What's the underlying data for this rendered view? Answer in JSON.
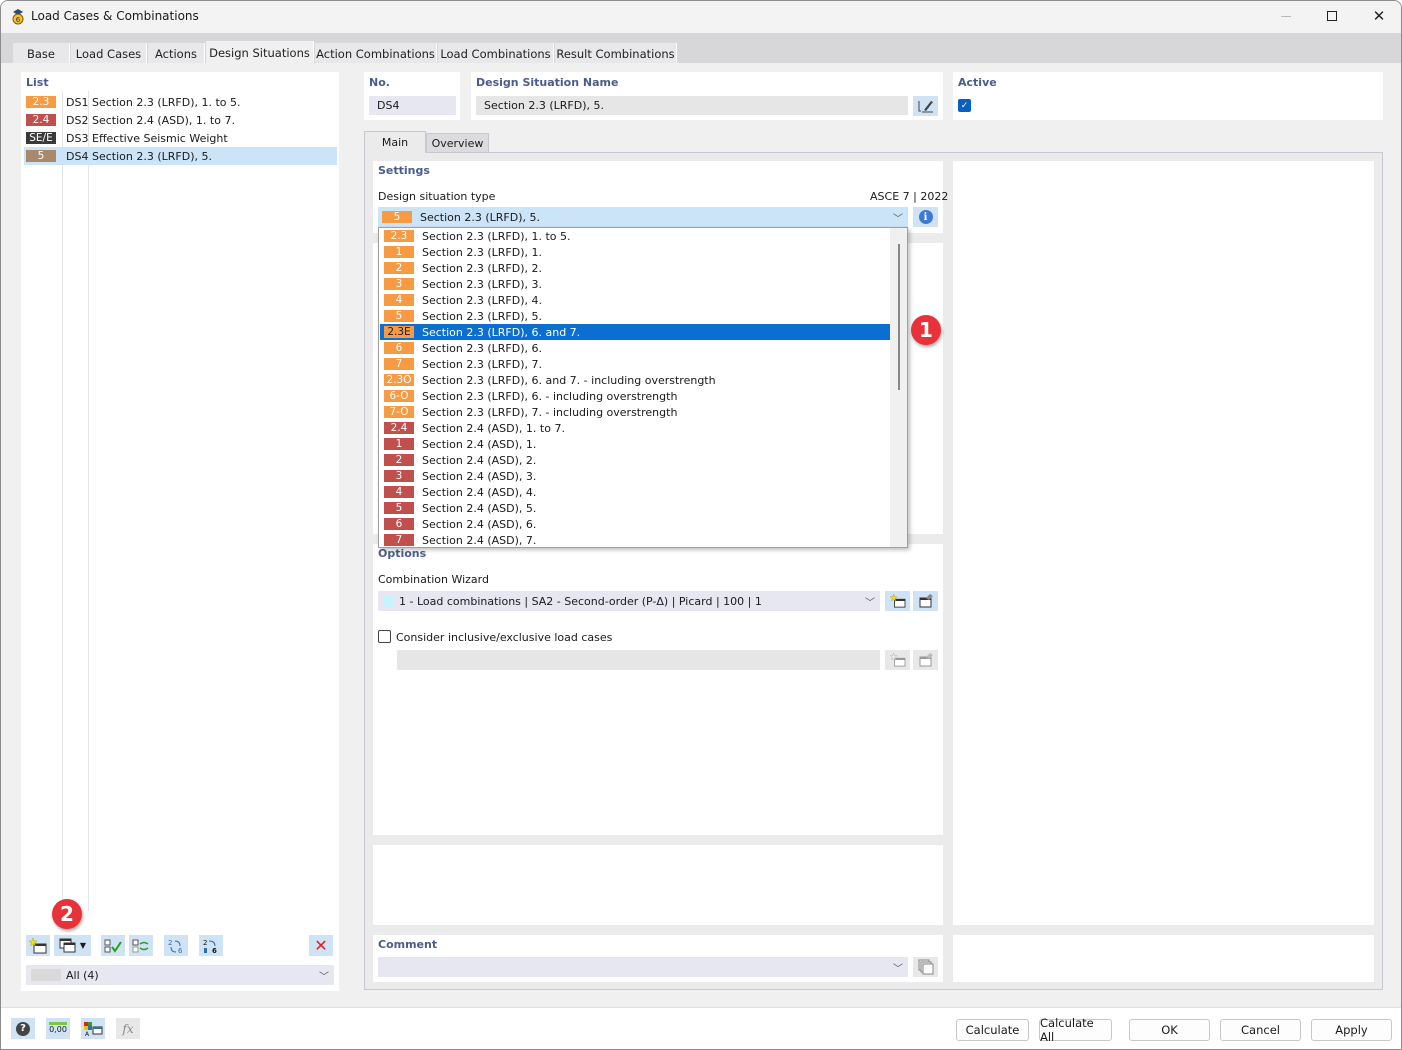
{
  "window": {
    "title": "Load Cases & Combinations",
    "controls": [
      "minimize",
      "maximize",
      "close"
    ]
  },
  "tabs": [
    {
      "label": "Base",
      "active": false
    },
    {
      "label": "Load Cases",
      "active": false
    },
    {
      "label": "Actions",
      "active": false
    },
    {
      "label": "Design Situations",
      "active": true
    },
    {
      "label": "Action Combinations",
      "active": false
    },
    {
      "label": "Load Combinations",
      "active": false
    },
    {
      "label": "Result Combinations",
      "active": false
    }
  ],
  "list": {
    "header": "List",
    "items": [
      {
        "badge": "2.3",
        "badge_color": "#f79a44",
        "no": "DS1",
        "name": "Section 2.3 (LRFD), 1. to 5.",
        "selected": false
      },
      {
        "badge": "2.4",
        "badge_color": "#c0504d",
        "no": "DS2",
        "name": "Section 2.4 (ASD), 1. to 7.",
        "selected": false
      },
      {
        "badge": "SE/E",
        "badge_color": "#3a3a3a",
        "no": "DS3",
        "name": "Effective Seismic Weight",
        "selected": false
      },
      {
        "badge": "5",
        "badge_color": "#a8896b",
        "no": "DS4",
        "name": "Section 2.3 (LRFD), 5.",
        "selected": true
      }
    ],
    "filter": {
      "value": "All (4)"
    }
  },
  "header": {
    "no_label": "No.",
    "no_value": "DS4",
    "name_label": "Design Situation Name",
    "name_value": "Section 2.3 (LRFD), 5.",
    "active_label": "Active",
    "active_checked": true
  },
  "subtabs": [
    {
      "label": "Main",
      "active": true
    },
    {
      "label": "Overview",
      "active": false
    }
  ],
  "settings": {
    "header": "Settings",
    "type_label": "Design situation type",
    "standard": "ASCE 7 | 2022",
    "selected": {
      "badge": "5",
      "text": "Section 2.3 (LRFD), 5."
    },
    "dropdown_options": [
      {
        "badge": "2.3",
        "color": "#f79a44",
        "text": "Section 2.3 (LRFD), 1. to 5."
      },
      {
        "badge": "1",
        "color": "#f79a44",
        "text": "Section 2.3 (LRFD), 1."
      },
      {
        "badge": "2",
        "color": "#f79a44",
        "text": "Section 2.3 (LRFD), 2."
      },
      {
        "badge": "3",
        "color": "#f79a44",
        "text": "Section 2.3 (LRFD), 3."
      },
      {
        "badge": "4",
        "color": "#f79a44",
        "text": "Section 2.3 (LRFD), 4."
      },
      {
        "badge": "5",
        "color": "#f79a44",
        "text": "Section 2.3 (LRFD), 5."
      },
      {
        "badge": "2.3E",
        "color": "#f79a44",
        "text": "Section 2.3 (LRFD), 6. and 7.",
        "highlighted": true
      },
      {
        "badge": "6",
        "color": "#f79a44",
        "text": "Section 2.3 (LRFD), 6."
      },
      {
        "badge": "7",
        "color": "#f79a44",
        "text": "Section 2.3 (LRFD), 7."
      },
      {
        "badge": "2.3O",
        "color": "#f79a44",
        "text": "Section 2.3 (LRFD), 6. and 7. - including overstrength"
      },
      {
        "badge": "6-O",
        "color": "#f79a44",
        "text": "Section 2.3 (LRFD), 6. - including overstrength"
      },
      {
        "badge": "7-O",
        "color": "#f79a44",
        "text": "Section 2.3 (LRFD), 7. - including overstrength"
      },
      {
        "badge": "2.4",
        "color": "#c0504d",
        "text": "Section 2.4 (ASD), 1. to 7."
      },
      {
        "badge": "1",
        "color": "#c0504d",
        "text": "Section 2.4 (ASD), 1."
      },
      {
        "badge": "2",
        "color": "#c0504d",
        "text": "Section 2.4 (ASD), 2."
      },
      {
        "badge": "3",
        "color": "#c0504d",
        "text": "Section 2.4 (ASD), 3."
      },
      {
        "badge": "4",
        "color": "#c0504d",
        "text": "Section 2.4 (ASD), 4."
      },
      {
        "badge": "5",
        "color": "#c0504d",
        "text": "Section 2.4 (ASD), 5."
      },
      {
        "badge": "6",
        "color": "#c0504d",
        "text": "Section 2.4 (ASD), 6."
      },
      {
        "badge": "7",
        "color": "#c0504d",
        "text": "Section 2.4 (ASD), 7."
      }
    ]
  },
  "options": {
    "header": "Options",
    "wizard_label": "Combination Wizard",
    "wizard_value": "1 - Load combinations | SA2 - Second-order (P-Δ) | Picard | 100 | 1",
    "inclusive_label": "Consider inclusive/exclusive load cases",
    "inclusive_checked": false
  },
  "comment": {
    "label": "Comment",
    "value": ""
  },
  "callouts": [
    "1",
    "2"
  ],
  "buttons": {
    "calculate": "Calculate",
    "calculate_all": "Calculate All",
    "ok": "OK",
    "cancel": "Cancel",
    "apply": "Apply"
  },
  "footer_icons": [
    "help-icon",
    "units-icon",
    "display-properties-icon",
    "formula-icon"
  ],
  "footer_units_text": "0,00",
  "colors": {
    "lrfd": "#f79a44",
    "asd": "#c0504d",
    "seismic": "#3a3a3a",
    "selected_row": "#cce4f7",
    "highlight": "#0a6fd1",
    "callout": "#e8323a"
  }
}
